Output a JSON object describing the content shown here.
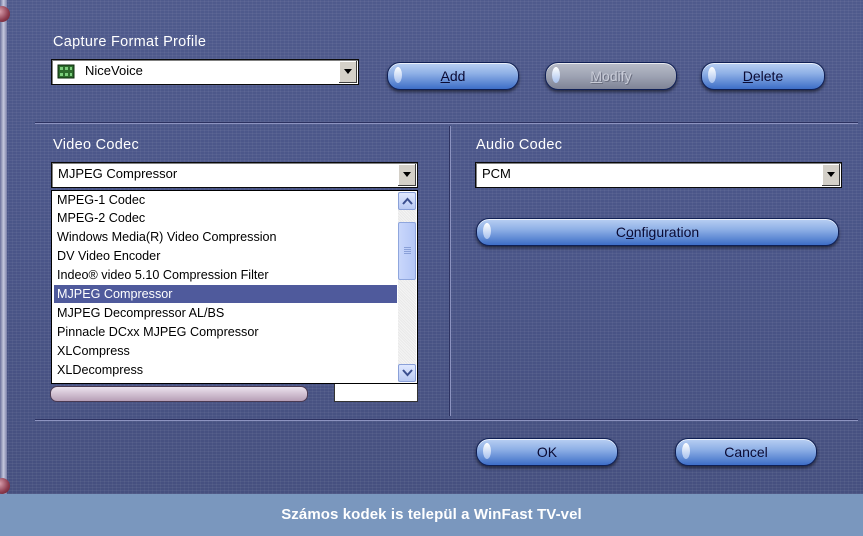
{
  "capture_profile": {
    "label": "Capture Format Profile",
    "selected": "NiceVoice",
    "icon": "film-icon"
  },
  "buttons": {
    "add": {
      "pre": "",
      "key": "A",
      "post": "dd"
    },
    "modify": {
      "pre": "",
      "key": "M",
      "post": "odify"
    },
    "delete": {
      "pre": "",
      "key": "D",
      "post": "elete"
    },
    "configuration": {
      "pre": "C",
      "key": "o",
      "post": "nfiguration"
    },
    "ok": "OK",
    "cancel": "Cancel"
  },
  "video_codec": {
    "label": "Video Codec",
    "selected": "MJPEG Compressor",
    "options": [
      "MPEG-1 Codec",
      "MPEG-2 Codec",
      "Windows Media(R) Video Compression",
      "DV Video Encoder",
      "Indeo® video 5.10 Compression Filter",
      "MJPEG Compressor",
      "MJPEG Decompressor AL/BS",
      "Pinnacle DCxx MJPEG Compressor",
      "XLCompress",
      "XLDecompress"
    ],
    "highlighted_index": 5
  },
  "audio_codec": {
    "label": "Audio Codec",
    "selected": "PCM"
  },
  "caption": "Számos kodek is települ a WinFast TV-vel",
  "colors": {
    "panel": "#4b5687",
    "selection": "#4f5a9c",
    "caption_bar": "#7a97be",
    "button_blue": "#8fb0e6"
  }
}
